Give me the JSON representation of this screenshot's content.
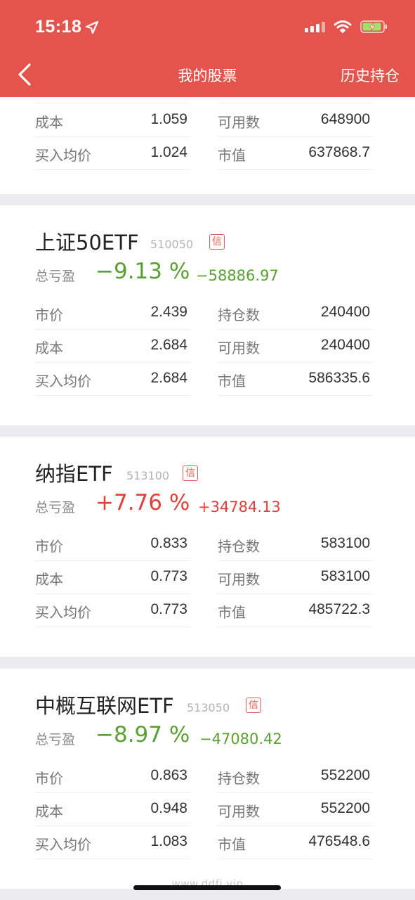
{
  "status_bar": {
    "time": "15:18",
    "icons": [
      "location-arrow-icon",
      "signal-icon",
      "wifi-icon",
      "battery-charging-icon"
    ]
  },
  "nav": {
    "title": "我的股票",
    "history": "历史持仓"
  },
  "colors": {
    "header": "#e4544c",
    "gain": "#e0403a",
    "loss": "#5aa033"
  },
  "top_card": {
    "rows": [
      {
        "l_label": "成本",
        "l_value": "1.059",
        "r_label": "可用数",
        "r_value": "648900"
      },
      {
        "l_label": "买入均价",
        "l_value": "1.024",
        "r_label": "市值",
        "r_value": "637868.7"
      }
    ]
  },
  "stocks": [
    {
      "name": "上证50ETF",
      "code": "510050",
      "badge": "信",
      "pl_label": "总亏盈",
      "pl_pct": "−9.13 %",
      "pl_amount": "−58886.97",
      "rows": [
        {
          "l_label": "市价",
          "l_value": "2.439",
          "r_label": "持仓数",
          "r_value": "240400"
        },
        {
          "l_label": "成本",
          "l_value": "2.684",
          "r_label": "可用数",
          "r_value": "240400"
        },
        {
          "l_label": "买入均价",
          "l_value": "2.684",
          "r_label": "市值",
          "r_value": "586335.6"
        }
      ]
    },
    {
      "name": "纳指ETF",
      "code": "513100",
      "badge": "信",
      "pl_label": "总亏盈",
      "pl_pct": "+7.76 %",
      "pl_amount": "+34784.13",
      "rows": [
        {
          "l_label": "市价",
          "l_value": "0.833",
          "r_label": "持仓数",
          "r_value": "583100"
        },
        {
          "l_label": "成本",
          "l_value": "0.773",
          "r_label": "可用数",
          "r_value": "583100"
        },
        {
          "l_label": "买入均价",
          "l_value": "0.773",
          "r_label": "市值",
          "r_value": "485722.3"
        }
      ]
    },
    {
      "name": "中概互联网ETF",
      "code": "513050",
      "badge": "信",
      "pl_label": "总亏盈",
      "pl_pct": "−8.97 %",
      "pl_amount": "−47080.42",
      "rows": [
        {
          "l_label": "市价",
          "l_value": "0.863",
          "r_label": "持仓数",
          "r_value": "552200"
        },
        {
          "l_label": "成本",
          "l_value": "0.948",
          "r_label": "可用数",
          "r_value": "552200"
        },
        {
          "l_label": "买入均价",
          "l_value": "1.083",
          "r_label": "市值",
          "r_value": "476548.6"
        }
      ]
    }
  ],
  "watermark": "www.ddfj.vip"
}
